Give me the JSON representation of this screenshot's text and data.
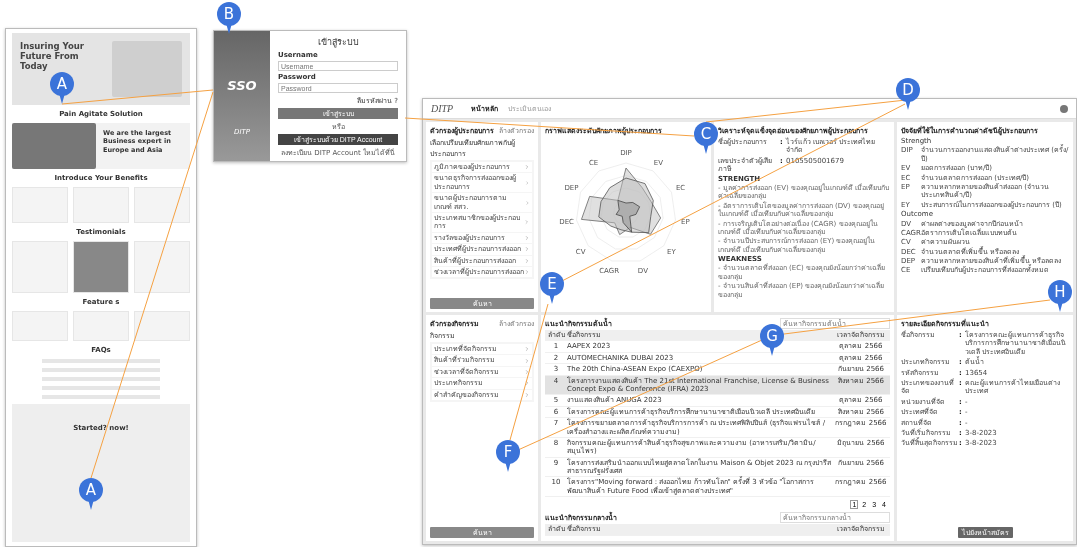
{
  "markers": [
    {
      "label": "A"
    },
    {
      "label": "B"
    },
    {
      "label": "C"
    },
    {
      "label": "D"
    },
    {
      "label": "E"
    },
    {
      "label": "F"
    },
    {
      "label": "G"
    },
    {
      "label": "H"
    },
    {
      "label": "A"
    }
  ],
  "landing_page": {
    "hero_title": "Insuring Your Future From Today",
    "sections": [
      {
        "kind": "heading",
        "text": "Pain Agitate Solution"
      },
      {
        "kind": "about",
        "text": "We are the largest Business expert in Europe and Asia"
      },
      {
        "kind": "heading",
        "text": "Introduce Your Benefits"
      },
      {
        "kind": "benefits"
      },
      {
        "kind": "heading",
        "text": "Testimonials"
      },
      {
        "kind": "testimonials"
      },
      {
        "kind": "heading",
        "text": "Feature s"
      },
      {
        "kind": "features"
      },
      {
        "kind": "heading",
        "text": "FAQs"
      },
      {
        "kind": "faqs"
      },
      {
        "kind": "cta",
        "text": "Started? now!"
      }
    ]
  },
  "login_page": {
    "logo": "SSO",
    "brand": "DITP",
    "title": "เข้าสู่ระบบ",
    "username_label": "Username",
    "username_placeholder": "Username",
    "password_label": "Password",
    "password_placeholder": "Password",
    "forgot": "ลืมรหัสผ่าน ?",
    "login_button": "เข้าสู่ระบบ",
    "or": "หรือ",
    "ditp_button": "เข้าสู่ระบบด้วย DITP Account",
    "register": "ลงทะเบียน DITP Account ใหม่ได้ที่นี่"
  },
  "dashboard": {
    "logo": "DITP",
    "nav": [
      {
        "label": "หน้าหลัก",
        "selected": true
      },
      {
        "label": "ประเมินตนเอง",
        "selected": false
      }
    ],
    "entrepreneur_filter": {
      "title": "ตัวกรองผู้ประกอบการ",
      "clear": "ล้างตัวกรอง",
      "subtitle": "เลือกเปรียบเทียบศักยภาพกับผู้ประกอบการ",
      "items": [
        "ภูมิภาคของผู้ประกอบการ",
        "ขนาดธุรกิจการส่งออกของผู้ประกอบการ",
        "ขนาดผู้ประกอบการตามเกณฑ์ สสว.",
        "ประเภทสมาชิกของผู้ประกอบการ",
        "รางวัลของผู้ประกอบการ",
        "ประเทศที่ผู้ประกอบการส่งออก",
        "สินค้าที่ผู้ประกอบการส่งออก",
        "ช่วงเวลาที่ผู้ประกอบการส่งออก"
      ],
      "button": "ค้นหา"
    },
    "radar": {
      "title": "กราฟแสดงระดับศักยภาพผู้ประกอบการ",
      "axes": [
        "DIP",
        "EV",
        "EC",
        "EP",
        "EY",
        "DV",
        "CAGR",
        "CV",
        "DEC",
        "DEP",
        "CE"
      ]
    },
    "analysis": {
      "title": "วิเคราะห์จุดแข็งจุดอ่อนของศักยภาพผู้ประกอบการ",
      "separator": ":",
      "fields": [
        {
          "label": "ชื่อผู้ประกอบการ",
          "value": "ไวร์แก้ว เบลเวอร์ ประเทศไทย จำกัด"
        },
        {
          "label": "เลขประจำตัวผู้เสียภาษี",
          "value": "0105505001679"
        }
      ],
      "groups": [
        {
          "title": "STRENGTH",
          "items": [
            "- มูลค่าการส่งออก (EV) ของคุณอยู่ในเกณฑ์ดี เมื่อเทียบกับค่าเฉลี่ยของกลุ่ม",
            "- อัตราการเติบโตของมูลค่าการส่งออก (DV) ของคุณอยู่ในเกณฑ์ดี เมื่อเทียบกับค่าเฉลี่ยของกลุ่ม",
            "- การเจริญเติบโตอย่างต่อเนื่อง (CAGR) ของคุณอยู่ในเกณฑ์ดี เมื่อเทียบกับค่าเฉลี่ยของกลุ่ม",
            "- จำนวนปีประสบการณ์การส่งออก (EY) ของคุณอยู่ในเกณฑ์ดี เมื่อเทียบกับค่าเฉลี่ยของกลุ่ม"
          ]
        },
        {
          "title": "WEAKNESS",
          "items": [
            "- จำนวนตลาดที่ส่งออก (EC) ของคุณยังน้อยกว่าค่าเฉลี่ยของกลุ่ม",
            "- จำนวนสินค้าที่ส่งออก (EP) ของคุณยังน้อยกว่าค่าเฉลี่ยของกลุ่ม"
          ]
        }
      ]
    },
    "factors": {
      "title": "ปัจจัยที่ใช้ในการคำนวณค่าดัชนีผู้ประกอบการ",
      "groups": [
        {
          "title": "Strength",
          "items": [
            {
              "code": "DIP",
              "text": "จำนวนการออกงานแสดงสินค้าต่างประเทศ (ครั้ง/ปี)"
            },
            {
              "code": "EV",
              "text": "ยอดการส่งออก (บาท/ปี)"
            },
            {
              "code": "EC",
              "text": "จำนวนตลาดการส่งออก (ประเทศ/ปี)"
            },
            {
              "code": "EP",
              "text": "ความหลากหลายของสินค้าส่งออก (จำนวนประเภทสินค้า/ปี)"
            },
            {
              "code": "EY",
              "text": "ประสบการณ์ในการส่งออกของผู้ประกอบการ (ปี)"
            }
          ]
        },
        {
          "title": "Outcome",
          "items": [
            {
              "code": "DV",
              "text": "ค่าผลต่างของมูลค่าจากปีก่อนหน้า"
            },
            {
              "code": "CAGR",
              "text": "อัตราการเติบโตเฉลี่ยแบบทบต้น"
            },
            {
              "code": "CV",
              "text": "ค่าความผันผวน"
            },
            {
              "code": "DEC",
              "text": "จำนวนตลาดที่เพิ่มขึ้น หรือลดลง"
            },
            {
              "code": "DEP",
              "text": "ความหลากหลายของสินค้าที่เพิ่มขึ้น หรือลดลง"
            },
            {
              "code": "CE",
              "text": "เปรียบเทียบกับผู้ประกอบการที่ส่งออกทั้งหมด"
            }
          ]
        }
      ]
    },
    "activity_filter": {
      "title": "ตัวกรองกิจกรรม",
      "clear": "ล้างตัวกรอง",
      "subtitle": "กิจกรรม",
      "items": [
        "ประเภทที่จัดกิจกรรม",
        "สินค้าที่ร่วมกิจกรรม",
        "ช่วงเวลาที่จัดกิจกรรม",
        "ประเภทกิจกรรม",
        "คำสำคัญของกิจกรรม"
      ],
      "button": "ค้นหา"
    },
    "upstream": {
      "title": "แนะนำกิจกรรมต้นน้ำ",
      "search_placeholder": "ค้นหากิจกรรมต้นน้ำ",
      "columns": [
        "ลำดับ",
        "ชื่อกิจกรรม",
        "เวลาจัดกิจกรรม"
      ],
      "rows": [
        {
          "no": "1",
          "name": "AAPEX 2023",
          "date": "ตุลาคม 2566",
          "selected": false
        },
        {
          "no": "2",
          "name": "AUTOMECHANIKA DUBAI 2023",
          "date": "ตุลาคม 2566",
          "selected": false
        },
        {
          "no": "3",
          "name": "The 20th China-ASEAN Expo (CAEXPO)",
          "date": "กันยายน 2566",
          "selected": false
        },
        {
          "no": "4",
          "name": "โครงการงานแสดงสินค้า The 21st International Franchise, License & Business Concept Expo & Conference (IFRA) 2023",
          "date": "สิงหาคม 2566",
          "selected": true
        },
        {
          "no": "5",
          "name": "งานแสดงสินค้า ANUGA 2023",
          "date": "ตุลาคม 2566",
          "selected": false
        },
        {
          "no": "6",
          "name": "โครงการคณะผู้แทนการค้าธุรกิจบริการศึกษานานาชาติเยือนนิวเดลี ประเทศอินเดีย",
          "date": "สิงหาคม 2566",
          "selected": false
        },
        {
          "no": "7",
          "name": "โครงการขยายตลาดการค้าธุรกิจบริการการค้า ณ ประเทศฟิลิปปินส์ (ธุรกิจแฟรนไชส์ / เครื่องสำอางและผลิตภัณฑ์ความงาม)",
          "date": "กรกฎาคม 2566",
          "selected": false
        },
        {
          "no": "8",
          "name": "กิจกรรมคณะผู้แทนการค้าสินค้าธุรกิจสุขภาพและความงาม (อาหารเสริม/วิตามิน/สมุนไพร)",
          "date": "มิถุนายน 2566",
          "selected": false
        },
        {
          "no": "9",
          "name": "โครงการส่งเสริมนำออกแบบไทยสู่ตลาดโลกในงาน Maison & Objet 2023 ณ กรุงปารีส สาธารณรัฐฝรั่งเศส",
          "date": "กันยายน 2566",
          "selected": false
        },
        {
          "no": "10",
          "name": "โครงการ\"Moving forward : ส่งออกไทย ก้าวทันโลก\" ครั้งที่ 3 หัวข้อ \"โอกาสการพัฒนาสินค้า Future Food เพื่อเข้าสู่ตลาดต่างประเทศ\"",
          "date": "กรกฎาคม 2566",
          "selected": false
        }
      ],
      "pages": [
        {
          "label": "1",
          "selected": true
        },
        {
          "label": "2",
          "selected": false
        },
        {
          "label": "3",
          "selected": false
        },
        {
          "label": "4",
          "selected": false
        }
      ]
    },
    "midstream": {
      "title": "แนะนำกิจกรรมกลางน้ำ",
      "search_placeholder": "ค้นหากิจกรรมกลางน้ำ",
      "columns": [
        "ลำดับ",
        "ชื่อกิจกรรม",
        "เวลาจัดกิจกรรม"
      ]
    },
    "detail": {
      "title": "รายละเอียดกิจกรรมที่แนะนำ",
      "separator": ":",
      "fields": [
        {
          "label": "ชื่อกิจกรรม",
          "value": "โครงการคณะผู้แทนการค้าธุรกิจบริการการศึกษานานาชาติเยือนนิวเดลี ประเทศอินเดีย"
        },
        {
          "label": "ประเภทกิจกรรม",
          "value": "ต้นน้ำ"
        },
        {
          "label": "รหัสกิจกรรม",
          "value": "13654"
        },
        {
          "label": "ประเภทของงานที่จัด",
          "value": "คณะผู้แทนการค้าไทยเยือนต่างประเทศ"
        },
        {
          "label": "หน่วยงานที่จัด",
          "value": "-"
        },
        {
          "label": "ประเทศที่จัด",
          "value": "-"
        },
        {
          "label": "สถานที่จัด",
          "value": "-"
        },
        {
          "label": "วันที่เริ่มกิจกรรม",
          "value": "3-8-2023"
        },
        {
          "label": "วันที่สิ้นสุดกิจกรรม",
          "value": "3-8-2023"
        }
      ],
      "button": "ไปยังหน้าสมัคร"
    }
  }
}
